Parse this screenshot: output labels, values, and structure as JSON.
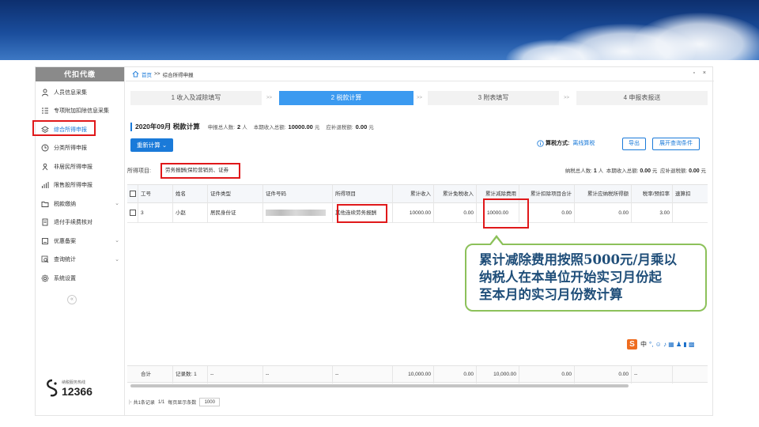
{
  "sidebar": {
    "title": "代扣代缴",
    "items": [
      {
        "label": "人员信息采集",
        "icon": "person-icon",
        "arrow": ""
      },
      {
        "label": "专项附加扣除信息采集",
        "icon": "list-icon",
        "arrow": ""
      },
      {
        "label": "综合所得申报",
        "icon": "layers-icon",
        "arrow": "",
        "active": true
      },
      {
        "label": "分类所得申报",
        "icon": "clock-icon",
        "arrow": ""
      },
      {
        "label": "非居民所得申报",
        "icon": "person-outline-icon",
        "arrow": ""
      },
      {
        "label": "限售股所得申报",
        "icon": "bar-chart-icon",
        "arrow": ""
      },
      {
        "label": "税款缴纳",
        "icon": "folder-icon",
        "arrow": "⌄"
      },
      {
        "label": "退付手续费核对",
        "icon": "document-icon",
        "arrow": ""
      },
      {
        "label": "优惠备案",
        "icon": "box-icon",
        "arrow": "⌄"
      },
      {
        "label": "查询统计",
        "icon": "search-icon",
        "arrow": "⌄"
      },
      {
        "label": "系统设置",
        "icon": "gear-icon",
        "arrow": ""
      }
    ],
    "collapse_glyph": "«",
    "hotline_label": "纳税服务热线",
    "hotline_number": "12366"
  },
  "breadcrumb": {
    "home": "首页",
    "sep": ">>",
    "current": "综合所得申报",
    "window_controls": "▫ ×"
  },
  "steps": [
    {
      "label": "1 收入及减除填写",
      "active": false
    },
    {
      "label": "2 税款计算",
      "active": true
    },
    {
      "label": "3 附表填写",
      "active": false
    },
    {
      "label": "4 申报表报送",
      "active": false
    }
  ],
  "step_separator": ">>",
  "header": {
    "title": "2020年09月 税款计算",
    "people_label": "申报总人数:",
    "people_value": "2",
    "people_unit": "人",
    "income_label": "本期收入总额:",
    "income_value": "10000.00",
    "income_unit": "元",
    "refund_label": "应补退税额:",
    "refund_value": "0.00",
    "refund_unit": "元"
  },
  "toolbar": {
    "recalc_label": "重新计算 ⌄",
    "taxmode_label": "算税方式:",
    "taxmode_value": "离线算税",
    "export_label": "导出",
    "expand_query_label": "展开查询条件"
  },
  "filter": {
    "label": "所得项目:",
    "value": "劳务报酬(保险营销员、证券"
  },
  "summary": {
    "taxpayers_label": "纳税总人数:",
    "taxpayers_value": "1",
    "taxpayers_unit": "人",
    "income_label": "本期收入总额:",
    "income_value": "0.00",
    "income_unit": "元",
    "refund_label": "应补退税额:",
    "refund_value": "0.00",
    "refund_unit": "元"
  },
  "table": {
    "columns": [
      "",
      "工号",
      "姓名",
      "证件类型",
      "证件号码",
      "所得项目",
      "累计收入",
      "累计免税收入",
      "累计减除费用",
      "累计扣除项目合计",
      "累计应纳税所得额",
      "税率/预扣率",
      "速算扣"
    ],
    "rows": [
      {
        "id": "3",
        "name": "小赵",
        "id_type": "居民身份证",
        "id_number": "",
        "item": "其他连续劳务报酬",
        "cum_income": "10000.00",
        "cum_exempt": "0.00",
        "cum_deduction": "10000.00",
        "cum_items_total": "0.00",
        "cum_taxable": "0.00",
        "rate": "3.00",
        "quick": ""
      }
    ],
    "totals": {
      "label": "合计",
      "records": "记录数: 1",
      "c1": "--",
      "c2": "--",
      "c3": "--",
      "cum_income": "10,000.00",
      "cum_exempt": "0.00",
      "cum_deduction": "10,000.00",
      "cum_items_total": "0.00",
      "cum_taxable": "0.00",
      "rate": "--"
    }
  },
  "pager": {
    "first_glyph": "|‹",
    "records_text": "共1条记录",
    "page_text": "1/1",
    "per_page_label": "每页显示条数",
    "per_page_value": "1000"
  },
  "callout": {
    "text_line1": "累计减除费用按照5000元/月乘以",
    "text_line2": "纳税人在本单位开始实习月份起",
    "text_line3": "至本月的实习月份数计算",
    "border_color": "#8cc15a",
    "text_color": "#1f4e79"
  },
  "ime_toolbar": {
    "logo": "S",
    "lang": "中",
    "glyphs": "°, ☺ ♪ ▦ ♟ ▮ ▩"
  },
  "colors": {
    "accent": "#1a7ad9",
    "highlight": "#e0181a",
    "banner": "#1a4d9c"
  }
}
